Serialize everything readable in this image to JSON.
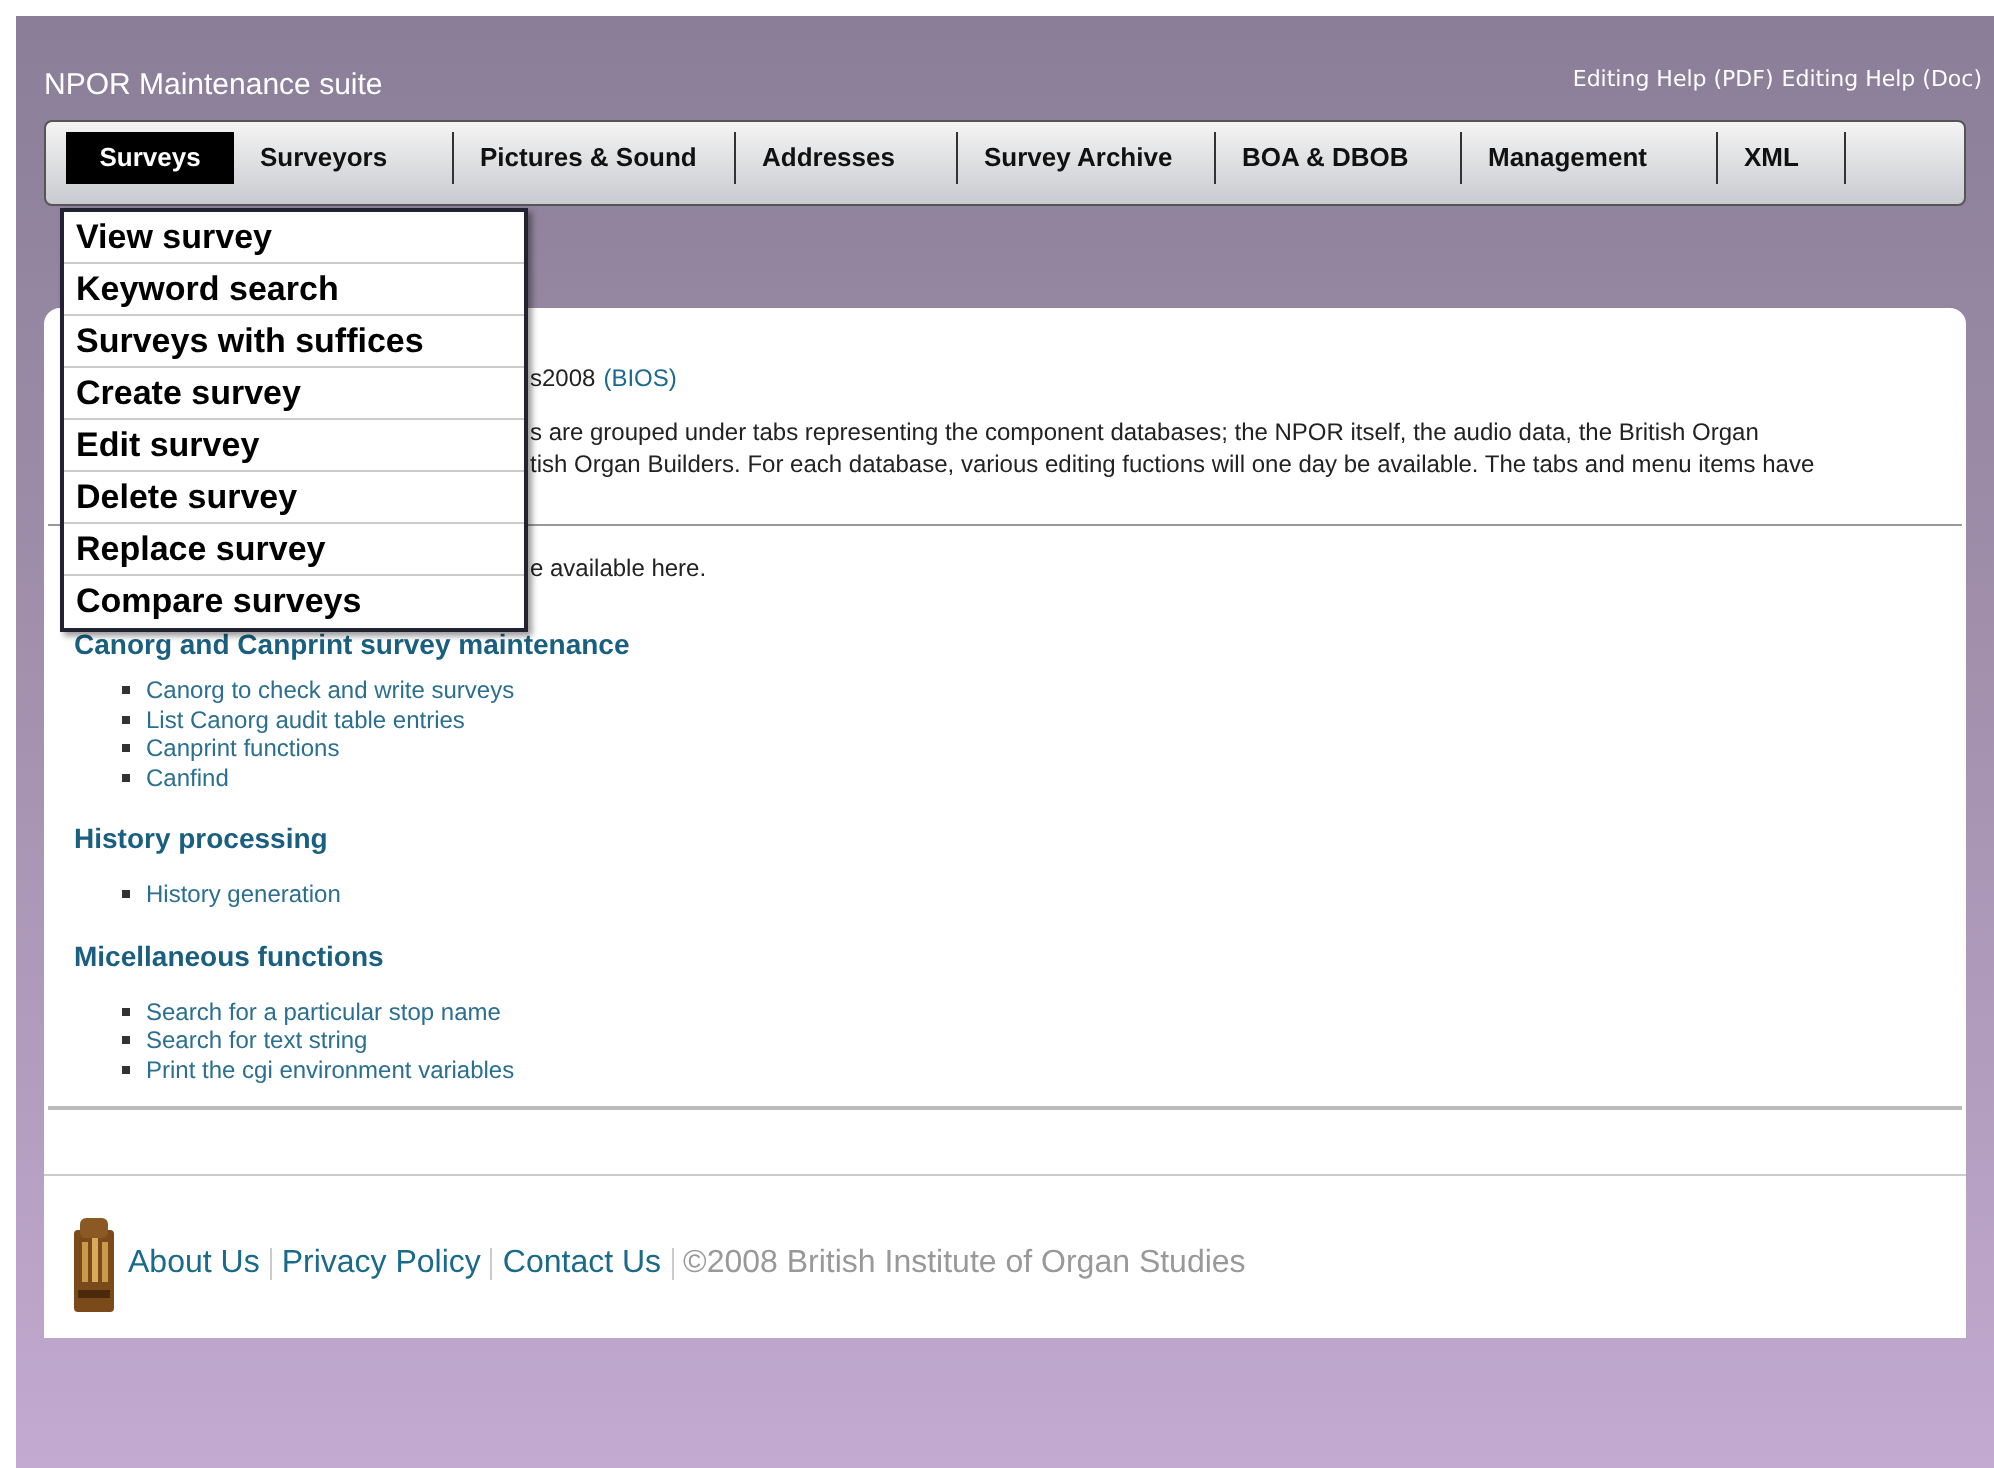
{
  "header": {
    "title": "NPOR Maintenance suite",
    "help_links": [
      "Editing Help (PDF)",
      "Editing Help (Doc)"
    ]
  },
  "tabs": [
    {
      "label": "Surveys",
      "selected": true
    },
    {
      "label": "Surveyors",
      "selected": false
    },
    {
      "label": "Pictures & Sound",
      "selected": false
    },
    {
      "label": "Addresses",
      "selected": false
    },
    {
      "label": "Survey Archive",
      "selected": false
    },
    {
      "label": "BOA & DBOB",
      "selected": false
    },
    {
      "label": "Management",
      "selected": false
    },
    {
      "label": "XML",
      "selected": false
    }
  ],
  "menu": [
    "View survey",
    "Keyword search",
    "Surveys with suffices",
    "Create survey",
    "Edit survey",
    "Delete survey",
    "Replace survey",
    "Compare surveys"
  ],
  "intro": {
    "line_1": "s2008",
    "line_1_link": "(BIOS)",
    "paragraph": [
      "s are grouped under tabs representing the component databases; the NPOR itself, the audio data, the British Organ",
      "tish Organ Builders. For each database, various editing fuctions will one day be available. The tabs and menu items have"
    ],
    "note": "e available here."
  },
  "sections": [
    {
      "heading": "Canorg and Canprint survey maintenance",
      "links": [
        "Canorg to check and write surveys",
        "List Canorg audit table entries",
        "Canprint functions",
        "Canfind"
      ]
    },
    {
      "heading": "History processing",
      "links": [
        "History generation"
      ]
    },
    {
      "heading": "Micellaneous functions",
      "links": [
        "Search for a particular stop name",
        "Search for text string",
        "Print the cgi environment variables"
      ]
    }
  ],
  "footer": {
    "links": [
      "About Us",
      "Privacy Policy",
      "Contact Us"
    ],
    "copyright": "©2008 British Institute of Organ Studies"
  }
}
